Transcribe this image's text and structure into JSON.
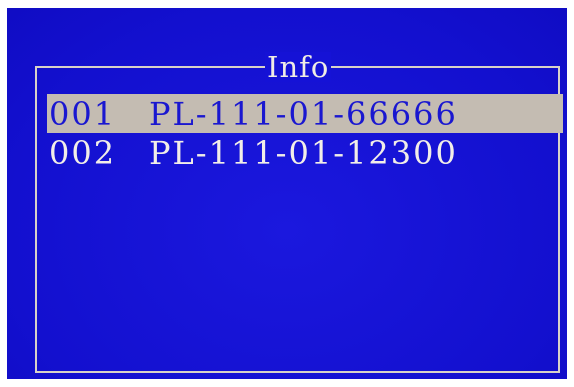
{
  "dialog": {
    "title": "Info"
  },
  "list": {
    "items": [
      {
        "index": "001",
        "code": "PL-111-01-66666",
        "selected": true
      },
      {
        "index": "002",
        "code": "PL-111-01-12300",
        "selected": false
      }
    ]
  },
  "colors": {
    "background": "#1512d6",
    "frame": "#d8d2c8",
    "highlight": "#c4bcb2",
    "text": "#f2eee8"
  }
}
